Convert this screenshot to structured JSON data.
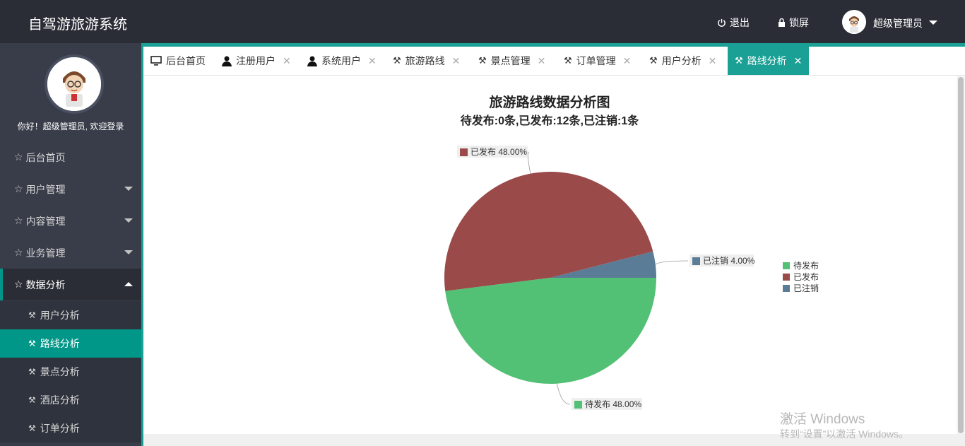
{
  "app": {
    "title": "自驾游旅游系统"
  },
  "header": {
    "logout_label": "退出",
    "lock_label": "锁屏",
    "user_name": "超级管理员"
  },
  "sidebar": {
    "welcome": "你好！超级管理员, 欢迎登录",
    "menu": [
      {
        "label": "后台首页"
      },
      {
        "label": "用户管理"
      },
      {
        "label": "内容管理"
      },
      {
        "label": "业务管理"
      },
      {
        "label": "数据分析"
      }
    ],
    "submenu": [
      {
        "label": "用户分析"
      },
      {
        "label": "路线分析"
      },
      {
        "label": "景点分析"
      },
      {
        "label": "酒店分析"
      },
      {
        "label": "订单分析"
      }
    ]
  },
  "tabs": [
    {
      "label": "后台首页",
      "icon": "monitor-icon"
    },
    {
      "label": "注册用户",
      "icon": "user-icon"
    },
    {
      "label": "系统用户",
      "icon": "user-icon"
    },
    {
      "label": "旅游路线",
      "icon": "tools-icon"
    },
    {
      "label": "景点管理",
      "icon": "tools-icon"
    },
    {
      "label": "订单管理",
      "icon": "tools-icon"
    },
    {
      "label": "用户分析",
      "icon": "tools-icon"
    },
    {
      "label": "路线分析",
      "icon": "tools-icon"
    }
  ],
  "chart_data": {
    "type": "pie",
    "title": "旅游路线数据分析图",
    "subtitle": "待发布:0条,已发布:12条,已注销:1条",
    "series": [
      {
        "name": "待发布",
        "value": 48.0,
        "label": "待发布 48.00%",
        "color": "#52c075"
      },
      {
        "name": "已发布",
        "value": 48.0,
        "label": "已发布 48.00%",
        "color": "#9b4a4a"
      },
      {
        "name": "已注销",
        "value": 4.0,
        "label": "已注销 4.00%",
        "color": "#5b7c96"
      }
    ],
    "legend_position": "right"
  },
  "watermark": {
    "line1": "激活 Windows",
    "line2": "转到“设置”以激活 Windows。"
  }
}
